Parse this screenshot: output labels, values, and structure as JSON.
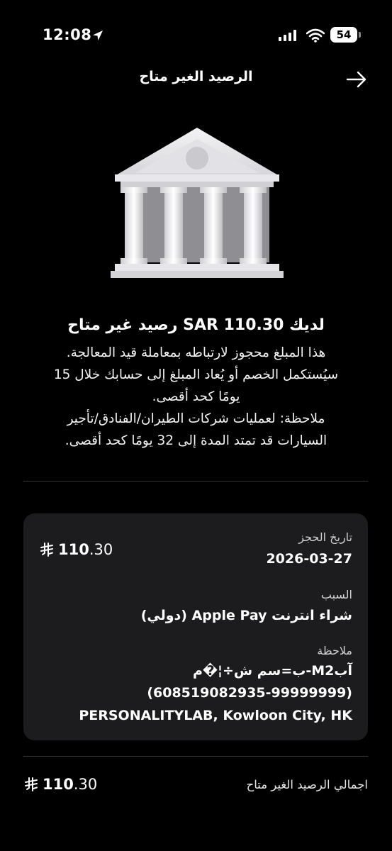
{
  "status_bar": {
    "time": "12:08",
    "battery": "54"
  },
  "header": {
    "title": "الرصيد الغير متاح"
  },
  "message": {
    "headline": "لديك SAR 110.30 رصيد غير متاح",
    "lines": [
      "هذا المبلغ محجوز لارتباطه بمعاملة قيد المعالجة.",
      "سيُستكمل الخصم أو يُعاد المبلغ إلى حسابك خلال 15",
      "يومًا كحد أقصى.",
      "ملاحظة: لعمليات شركات الطيران/الفنادق/تأجير",
      "السيارات قد تمتد المدة إلى 32 يومًا كحد أقصى."
    ]
  },
  "details": {
    "amount_int": "110",
    "amount_dec": ".30",
    "booking_date_label": "تاريخ الحجز",
    "booking_date": "2026-03-27",
    "reason_label": "السبب",
    "reason": "شراء انترنت Apple Pay (دولي)",
    "note_label": "ملاحظة",
    "note_lines": [
      "آبM2-ب=سم ش÷¦�م",
      "(608519082935-99999999)",
      "PERSONALITYLAB, Kowloon City, HK"
    ]
  },
  "total": {
    "label": "اجمالي الرصيد الغير متاح",
    "amount_int": "110",
    "amount_dec": ".30"
  }
}
